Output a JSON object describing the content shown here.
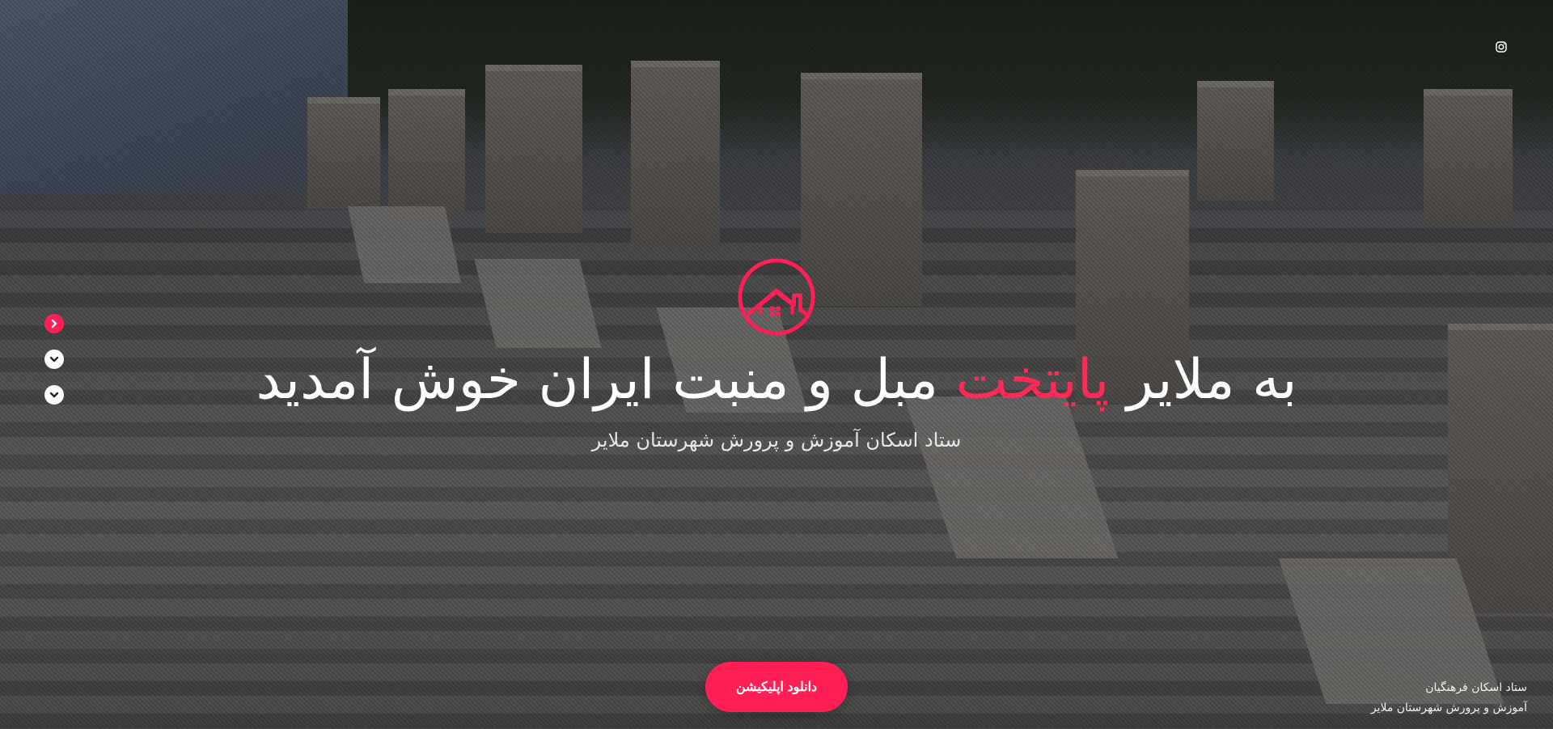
{
  "hero": {
    "title_part1": "به ملایر ",
    "title_accent": "پایتخت",
    "title_part2": " مبل و منبت ایران خوش آمدید",
    "subtitle": "ستاد اسکان آموزش و پرورش شهرستان ملایر"
  },
  "download_button": {
    "label": "دانلود اپلیکیشن"
  },
  "footer_note": {
    "line1": "ستاد اسکان فرهنگیان",
    "line2": "آموزش و پرورش شهرستان ملایر"
  },
  "icons": {
    "social": "instagram-icon",
    "logo": "house-logo-icon",
    "nav_active": "chevron-right-icon",
    "nav_idle": "chevron-down-icon"
  },
  "colors": {
    "accent": "#ff1f55",
    "title_text": "#ffffff",
    "subtitle_text": "#e6e6e6"
  }
}
